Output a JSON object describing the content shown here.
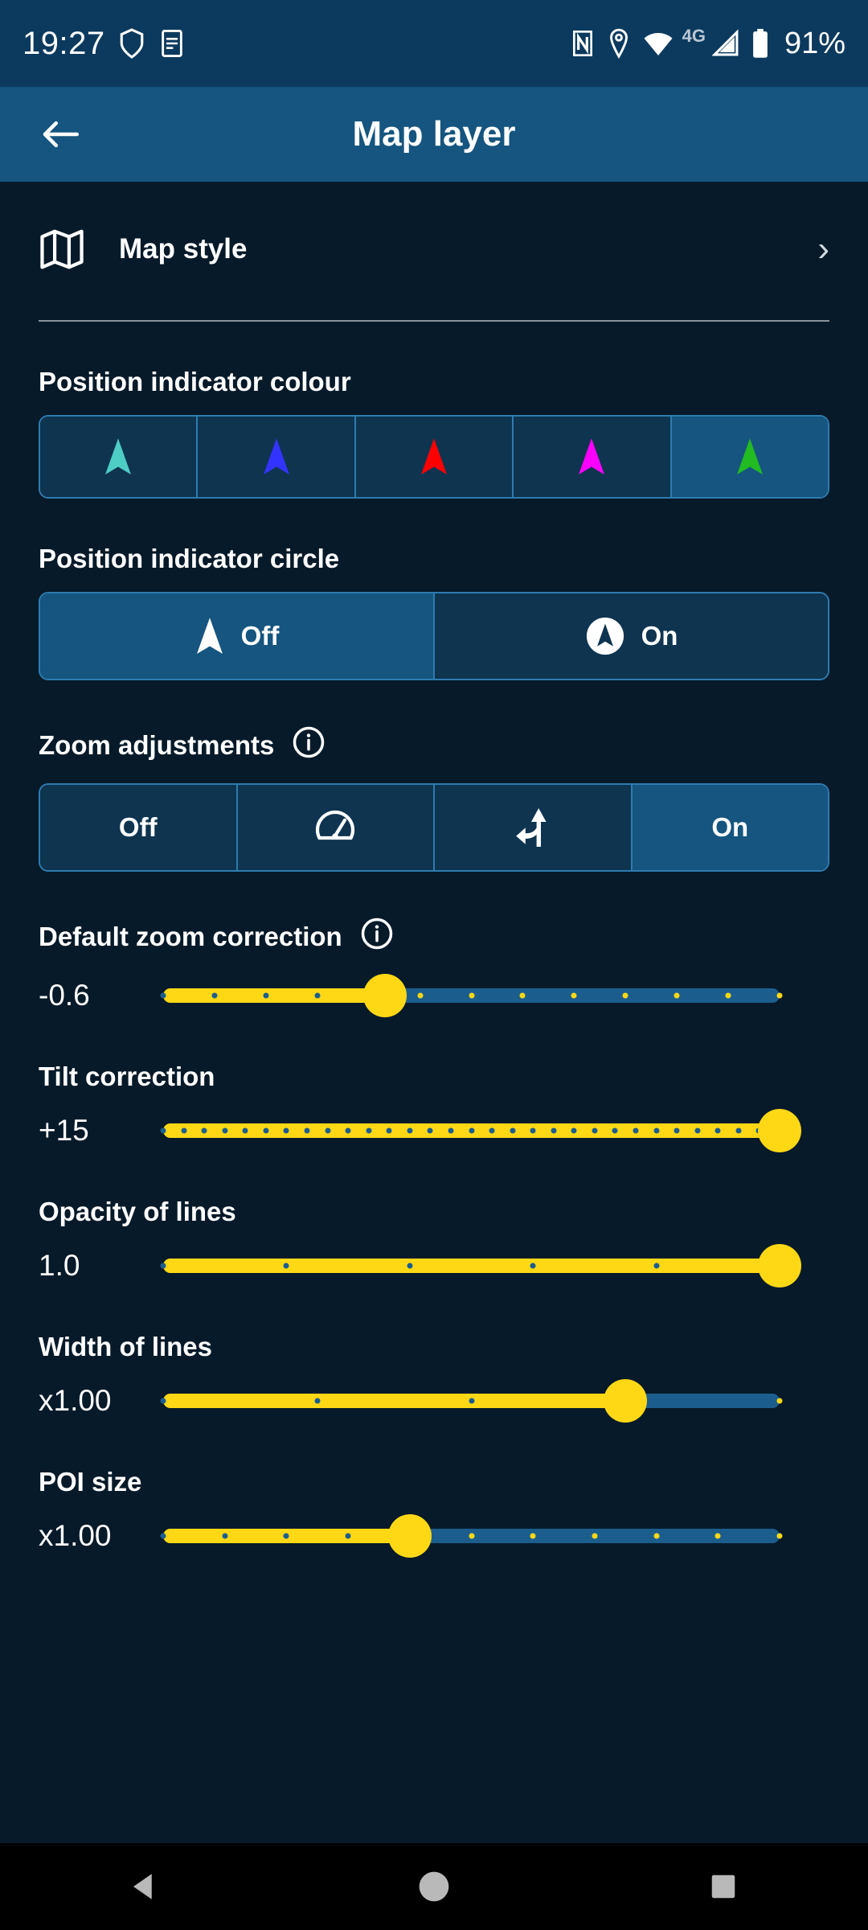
{
  "statusbar": {
    "time": "19:27",
    "battery": "91%",
    "network": "4G",
    "icons": [
      "shield-icon",
      "notes-icon",
      "nfc-icon",
      "location-pin-icon",
      "wifi-icon",
      "signal-icon",
      "battery-icon"
    ]
  },
  "appbar": {
    "title": "Map layer",
    "back_label": "Back"
  },
  "map_style": {
    "label": "Map style",
    "icon": "map-icon",
    "chevron": "›"
  },
  "position_colour": {
    "label": "Position indicator colour",
    "options": [
      {
        "name": "teal",
        "colour": "#4ECDC4",
        "selected": false
      },
      {
        "name": "blue",
        "colour": "#3333FF",
        "selected": false
      },
      {
        "name": "red",
        "colour": "#FF0000",
        "selected": false
      },
      {
        "name": "magenta",
        "colour": "#FF00FF",
        "selected": false
      },
      {
        "name": "green",
        "colour": "#22BB22",
        "selected": true
      }
    ]
  },
  "position_circle": {
    "label": "Position indicator circle",
    "options": [
      {
        "label": "Off",
        "icon": "arrow-icon",
        "selected": true
      },
      {
        "label": "On",
        "icon": "arrow-circle-icon",
        "selected": false
      }
    ]
  },
  "zoom_adjustments": {
    "label": "Zoom adjustments",
    "info": "info-icon",
    "options": [
      {
        "label": "Off",
        "icon": "",
        "selected": false
      },
      {
        "label": "",
        "icon": "speedometer-icon",
        "selected": false
      },
      {
        "label": "",
        "icon": "turn-fork-icon",
        "selected": false
      },
      {
        "label": "On",
        "icon": "",
        "selected": true
      }
    ]
  },
  "sliders": [
    {
      "label": "Default zoom correction",
      "info": "info-icon",
      "value": "-0.6",
      "percent": 36,
      "ticks": 13
    },
    {
      "label": "Tilt correction",
      "info": "",
      "value": "+15",
      "percent": 100,
      "ticks": 31
    },
    {
      "label": "Opacity of lines",
      "info": "",
      "value": "1.0",
      "percent": 100,
      "ticks": 6
    },
    {
      "label": "Width of lines",
      "info": "",
      "value": "x1.00",
      "percent": 75,
      "ticks": 5
    },
    {
      "label": "POI size",
      "info": "",
      "value": "x1.00",
      "percent": 40,
      "ticks": 11
    }
  ],
  "navbar": {
    "back": "nav-back-icon",
    "home": "nav-home-icon",
    "recents": "nav-recents-icon"
  },
  "colors": {
    "statusbar_bg": "#0c3a5e",
    "appbar_bg": "#15557f",
    "content_bg": "#071a29",
    "segment_bg": "#0e3450",
    "segment_selected_bg": "#15557f",
    "segment_border": "#2e7cb0",
    "slider_fill": "#FFD815",
    "slider_track": "#1b5e8e"
  }
}
